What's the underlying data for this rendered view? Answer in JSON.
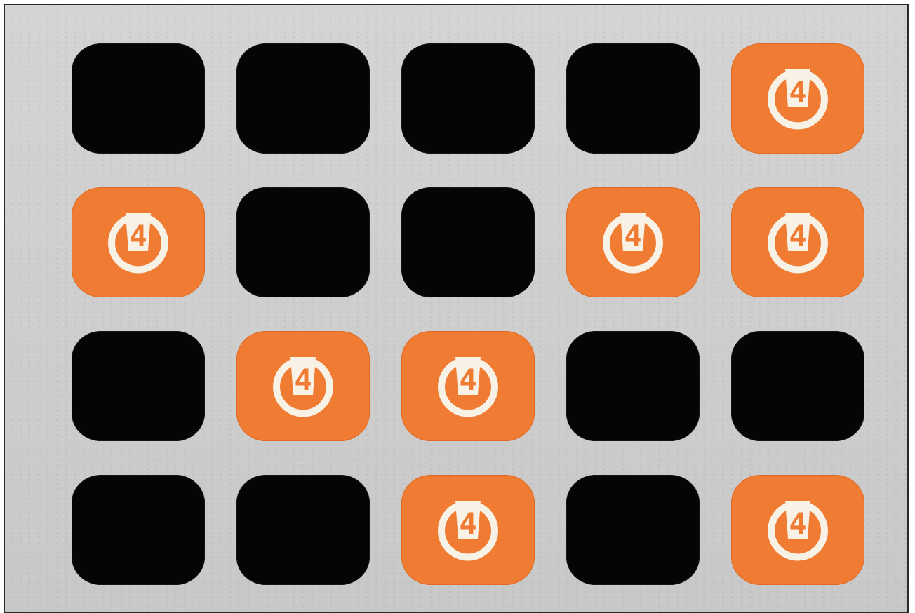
{
  "colors": {
    "background": "#cfcfcf",
    "black_tile": "#050505",
    "orange_tile": "#f07c34",
    "logo": "#f7f1e6"
  },
  "logo": {
    "icon": "channel-4-logo-icon",
    "label": "4"
  },
  "grid": {
    "rows": [
      [
        "black",
        "black",
        "black",
        "black",
        "orange"
      ],
      [
        "orange",
        "black",
        "black",
        "orange",
        "orange"
      ],
      [
        "black",
        "orange",
        "orange",
        "black",
        "black"
      ],
      [
        "black",
        "black",
        "orange",
        "black",
        "orange"
      ]
    ]
  }
}
